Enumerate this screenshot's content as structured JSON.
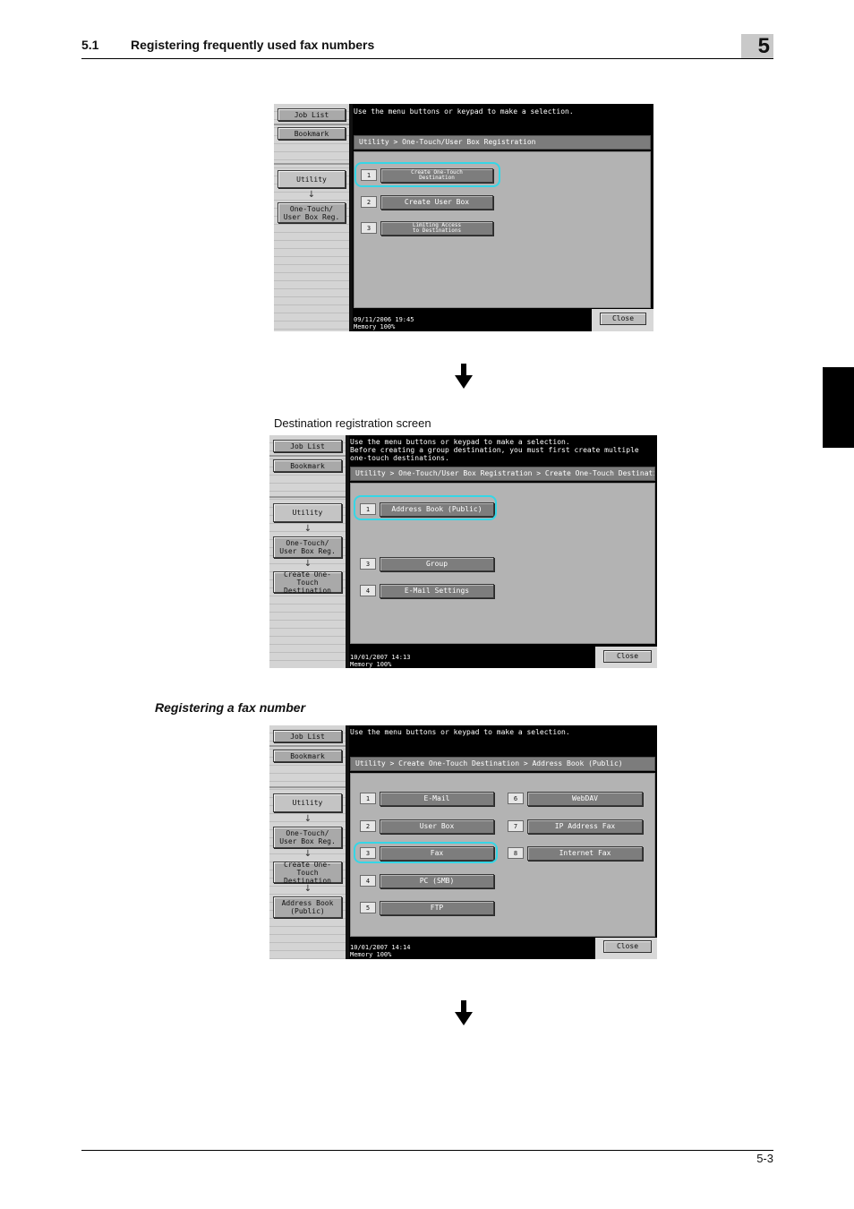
{
  "header": {
    "section_number": "5.1",
    "section_title": "Registering frequently used fax numbers",
    "chapter": "5"
  },
  "captions": {
    "destination_screen": "Destination registration screen",
    "fax_heading": "Registering a fax number"
  },
  "footer": {
    "page": "5-3"
  },
  "panel1": {
    "sidebar": {
      "job_list": "Job List",
      "bookmark": "Bookmark",
      "crumbs": [
        "Utility",
        "One-Touch/\nUser Box Reg."
      ]
    },
    "message": "Use the menu buttons or keypad to make a selection.",
    "title_bar": "Utility > One-Touch/User Box Registration",
    "items": [
      {
        "num": "1",
        "label": "Create One-Touch\nDestination"
      },
      {
        "num": "2",
        "label": "Create User Box"
      },
      {
        "num": "3",
        "label": "Limiting Access\nto Destinations"
      }
    ],
    "status": "09/11/2006    19:45\nMemory        100%",
    "close": "Close"
  },
  "panel2": {
    "sidebar": {
      "job_list": "Job List",
      "bookmark": "Bookmark",
      "crumbs": [
        "Utility",
        "One-Touch/\nUser Box Reg.",
        "Create One-Touch\nDestination"
      ]
    },
    "message": "Use the menu buttons or keypad to make a selection.\nBefore creating a group destination, you must first create multiple\none-touch destinations.",
    "title_bar": "Utility > One-Touch/User Box Registration > Create One-Touch Destination",
    "items": [
      {
        "num": "1",
        "label": "Address Book (Public)"
      },
      {
        "num": "3",
        "label": "Group"
      },
      {
        "num": "4",
        "label": "E-Mail Settings"
      }
    ],
    "status": "10/01/2007    14:13\nMemory        100%",
    "close": "Close"
  },
  "panel3": {
    "sidebar": {
      "job_list": "Job List",
      "bookmark": "Bookmark",
      "crumbs": [
        "Utility",
        "One-Touch/\nUser Box Reg.",
        "Create One-Touch\nDestination",
        "Address Book\n(Public)"
      ]
    },
    "message": "Use the menu buttons or keypad to make a selection.",
    "title_bar": "Utility > Create One-Touch Destination > Address Book (Public)",
    "items_left": [
      {
        "num": "1",
        "label": "E-Mail"
      },
      {
        "num": "2",
        "label": "User Box"
      },
      {
        "num": "3",
        "label": "Fax"
      },
      {
        "num": "4",
        "label": "PC (SMB)"
      },
      {
        "num": "5",
        "label": "FTP"
      }
    ],
    "items_right": [
      {
        "num": "6",
        "label": "WebDAV"
      },
      {
        "num": "7",
        "label": "IP Address Fax"
      },
      {
        "num": "8",
        "label": "Internet Fax"
      }
    ],
    "status": "10/01/2007    14:14\nMemory        100%",
    "close": "Close"
  },
  "colors": {
    "highlight": "#35d6e6",
    "chapter_box": "#c9c9c9"
  }
}
